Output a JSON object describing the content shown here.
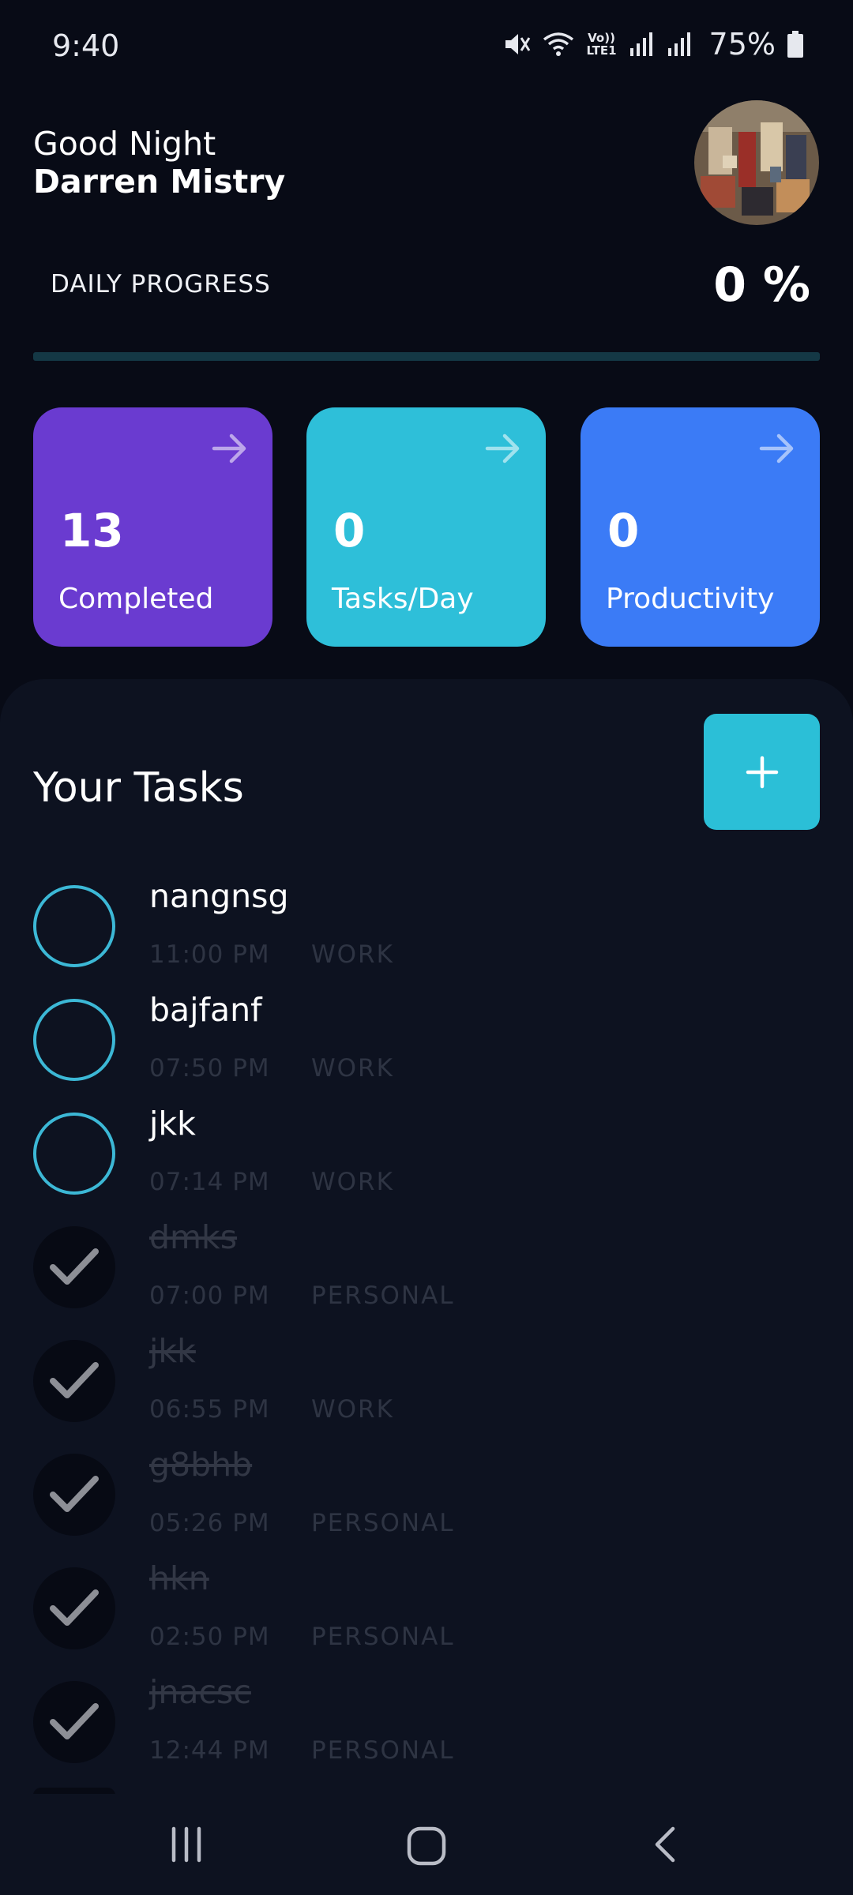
{
  "status_bar": {
    "time": "9:40",
    "network": "Vo)) LTE1",
    "battery": "75%",
    "icons": [
      "mute-icon",
      "wifi-icon",
      "volte-icon",
      "signal-icon",
      "signal-icon",
      "battery-icon"
    ]
  },
  "header": {
    "greeting": "Good Night",
    "user_name": "Darren Mistry",
    "avatar_icon": "profile-photo"
  },
  "progress": {
    "label": "DAILY PROGRESS",
    "value_text": "0 %",
    "fraction": 0,
    "track_color": "#143845",
    "fill_color": "#2bbfd7"
  },
  "cards": [
    {
      "value": "13",
      "label": "Completed",
      "color": "#6a3bd0",
      "icon": "arrow-right-icon"
    },
    {
      "value": "0",
      "label": "Tasks/Day",
      "color": "#2ebfd9",
      "icon": "arrow-right-icon"
    },
    {
      "value": "0",
      "label": "Productivity",
      "color": "#3b7bf6",
      "icon": "arrow-right-icon"
    }
  ],
  "tasks_section": {
    "title": "Your Tasks",
    "add_icon": "plus-icon",
    "add_color": "#2bbfd7"
  },
  "tasks": [
    {
      "name": "nangnsg",
      "time": "11:00 PM",
      "tag": "WORK",
      "done": false
    },
    {
      "name": "bajfanf",
      "time": "07:50 PM",
      "tag": "WORK",
      "done": false
    },
    {
      "name": "jkk",
      "time": "07:14 PM",
      "tag": "WORK",
      "done": false
    },
    {
      "name": "dmks",
      "time": "07:00 PM",
      "tag": "PERSONAL",
      "done": true
    },
    {
      "name": "jkk",
      "time": "06:55 PM",
      "tag": "WORK",
      "done": true
    },
    {
      "name": "g8bhb",
      "time": "05:26 PM",
      "tag": "PERSONAL",
      "done": true
    },
    {
      "name": "hkn",
      "time": "02:50 PM",
      "tag": "PERSONAL",
      "done": true
    },
    {
      "name": "jnacsc",
      "time": "12:44 PM",
      "tag": "PERSONAL",
      "done": true
    }
  ],
  "nav": {
    "recents_icon": "recents-icon",
    "home_icon": "home-icon",
    "back_icon": "back-icon"
  }
}
